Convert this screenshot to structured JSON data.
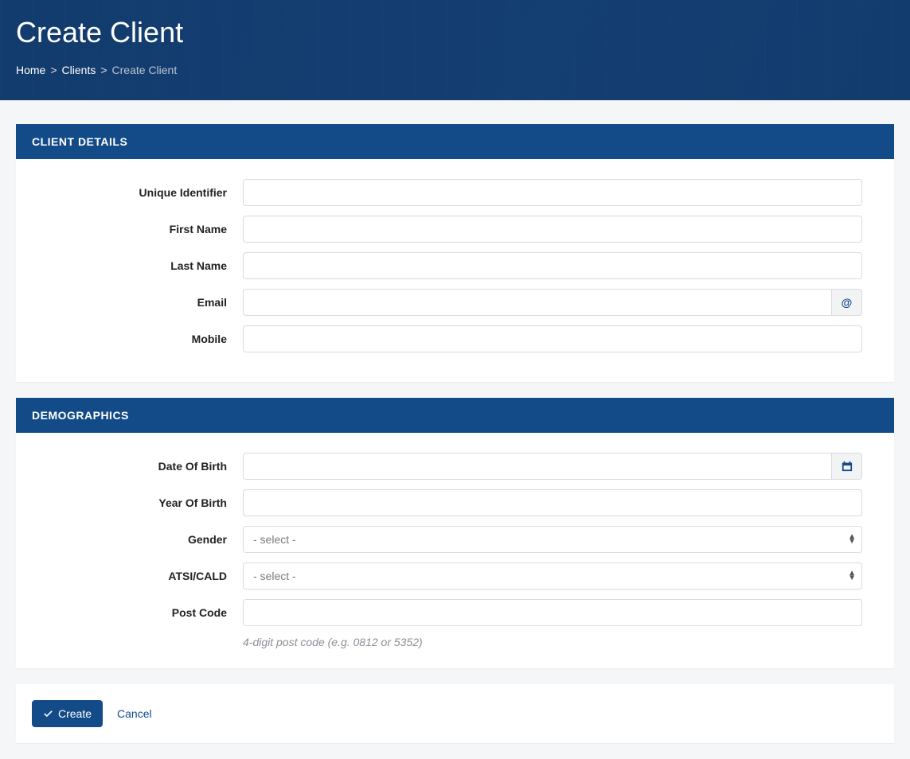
{
  "page": {
    "title": "Create Client"
  },
  "breadcrumb": {
    "home": "Home",
    "clients": "Clients",
    "current": "Create Client",
    "sep": ">"
  },
  "panels": {
    "client_details": {
      "heading": "CLIENT DETAILS",
      "fields": {
        "unique_identifier": {
          "label": "Unique Identifier",
          "value": ""
        },
        "first_name": {
          "label": "First Name",
          "value": ""
        },
        "last_name": {
          "label": "Last Name",
          "value": ""
        },
        "email": {
          "label": "Email",
          "value": "",
          "addon": "@"
        },
        "mobile": {
          "label": "Mobile",
          "value": ""
        }
      }
    },
    "demographics": {
      "heading": "DEMOGRAPHICS",
      "fields": {
        "dob": {
          "label": "Date Of Birth",
          "value": ""
        },
        "yob": {
          "label": "Year Of Birth",
          "value": ""
        },
        "gender": {
          "label": "Gender",
          "placeholder": "- select -",
          "value": ""
        },
        "atsi_cald": {
          "label": "ATSI/CALD",
          "placeholder": "- select -",
          "value": ""
        },
        "postcode": {
          "label": "Post Code",
          "value": "",
          "help": "4-digit post code (e.g. 0812 or 5352)"
        }
      }
    }
  },
  "actions": {
    "create": "Create",
    "cancel": "Cancel"
  }
}
